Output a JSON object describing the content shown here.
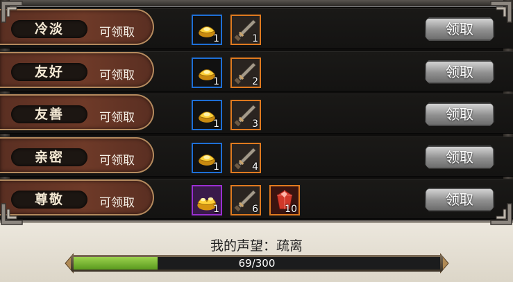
{
  "rows": [
    {
      "name": "冷淡",
      "status": "可领取",
      "claim": "领取",
      "items": [
        {
          "icon": "gold-ingot-icon",
          "qty": "1",
          "frame": "blue"
        },
        {
          "icon": "dagger-icon",
          "qty": "1",
          "frame": "orange"
        }
      ]
    },
    {
      "name": "友好",
      "status": "可领取",
      "claim": "领取",
      "items": [
        {
          "icon": "gold-ingot-icon",
          "qty": "1",
          "frame": "blue"
        },
        {
          "icon": "dagger-icon",
          "qty": "2",
          "frame": "orange"
        }
      ]
    },
    {
      "name": "友善",
      "status": "可领取",
      "claim": "领取",
      "items": [
        {
          "icon": "gold-ingot-icon",
          "qty": "1",
          "frame": "blue"
        },
        {
          "icon": "dagger-icon",
          "qty": "3",
          "frame": "orange"
        }
      ]
    },
    {
      "name": "亲密",
      "status": "可领取",
      "claim": "领取",
      "items": [
        {
          "icon": "gold-ingot-icon",
          "qty": "1",
          "frame": "blue"
        },
        {
          "icon": "dagger-icon",
          "qty": "4",
          "frame": "orange"
        }
      ]
    },
    {
      "name": "尊敬",
      "status": "可领取",
      "claim": "领取",
      "items": [
        {
          "icon": "gold-pile-icon",
          "qty": "1",
          "frame": "purple"
        },
        {
          "icon": "dagger-icon",
          "qty": "6",
          "frame": "orange"
        },
        {
          "icon": "red-gem-icon",
          "qty": "10",
          "frame": "orange"
        }
      ]
    }
  ],
  "reputation": {
    "label": "我的声望：疏离",
    "progress_text": "69/300",
    "current": 69,
    "max": 300
  },
  "colors": {
    "blue_frame": "#1e6fd6",
    "orange_frame": "#e07a1f",
    "purple_frame": "#9a2fd1",
    "bar_fill": "#7fbf35"
  }
}
